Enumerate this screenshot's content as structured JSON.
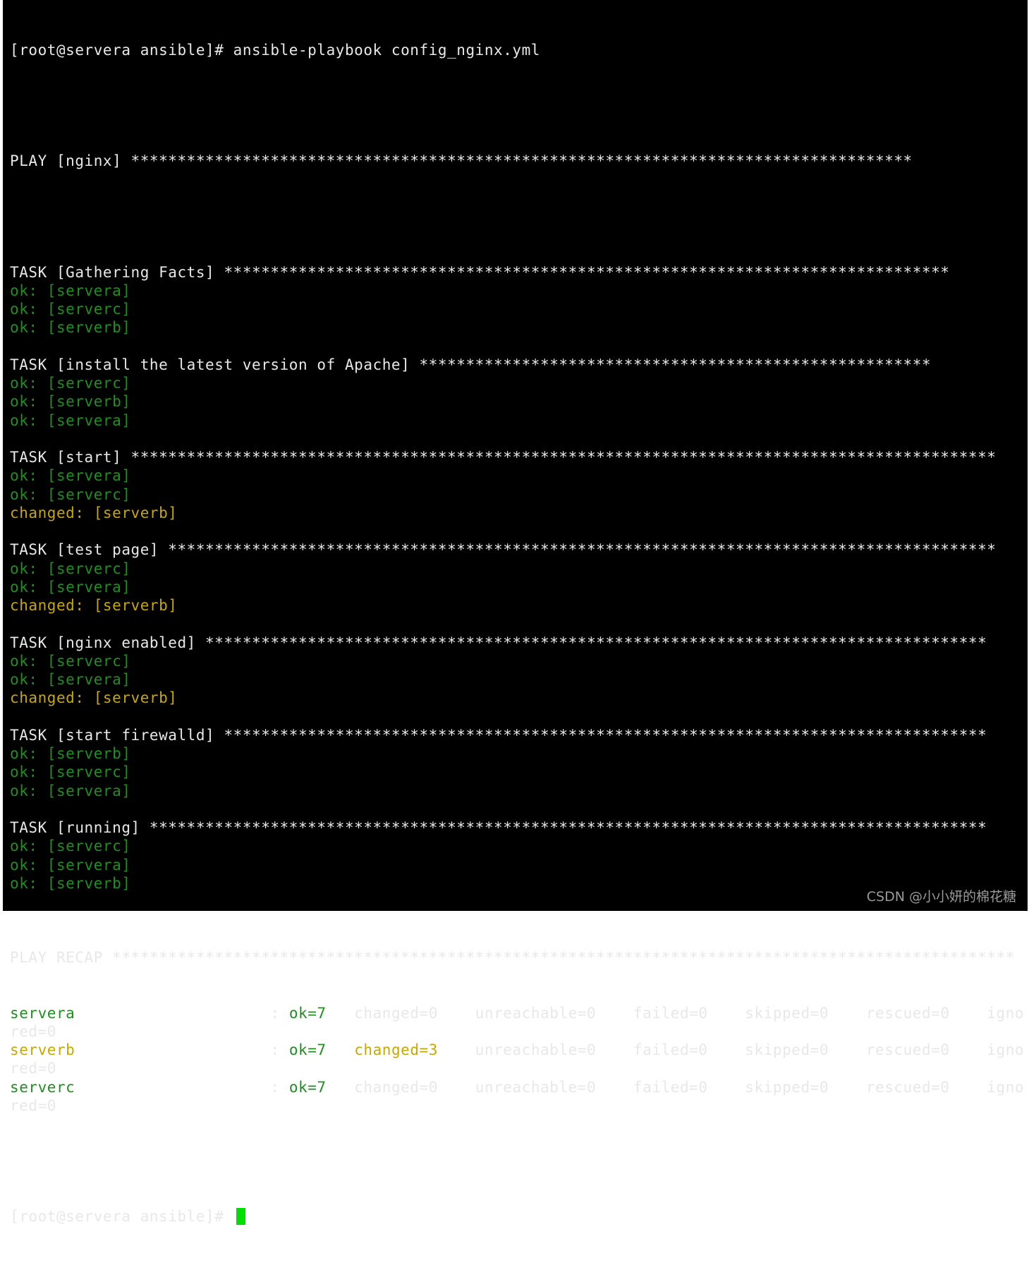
{
  "terminal": {
    "command_line": "[root@servera ansible]# ansible-playbook config_nginx.yml",
    "play_header": "PLAY [nginx] ************************************************************************************",
    "tasks": [
      {
        "header": "TASK [Gathering Facts] ******************************************************************************",
        "results": [
          {
            "status": "ok",
            "text": "ok: [servera]"
          },
          {
            "status": "ok",
            "text": "ok: [serverc]"
          },
          {
            "status": "ok",
            "text": "ok: [serverb]"
          }
        ]
      },
      {
        "header": "TASK [install the latest version of Apache] *******************************************************",
        "results": [
          {
            "status": "ok",
            "text": "ok: [serverc]"
          },
          {
            "status": "ok",
            "text": "ok: [serverb]"
          },
          {
            "status": "ok",
            "text": "ok: [servera]"
          }
        ]
      },
      {
        "header": "TASK [start] *********************************************************************************************",
        "results": [
          {
            "status": "ok",
            "text": "ok: [servera]"
          },
          {
            "status": "ok",
            "text": "ok: [serverc]"
          },
          {
            "status": "changed",
            "text": "changed: [serverb]"
          }
        ]
      },
      {
        "header": "TASK [test page] *****************************************************************************************",
        "results": [
          {
            "status": "ok",
            "text": "ok: [serverc]"
          },
          {
            "status": "ok",
            "text": "ok: [servera]"
          },
          {
            "status": "changed",
            "text": "changed: [serverb]"
          }
        ]
      },
      {
        "header": "TASK [nginx enabled] ************************************************************************************",
        "results": [
          {
            "status": "ok",
            "text": "ok: [serverc]"
          },
          {
            "status": "ok",
            "text": "ok: [servera]"
          },
          {
            "status": "changed",
            "text": "changed: [serverb]"
          }
        ]
      },
      {
        "header": "TASK [start firewalld] **********************************************************************************",
        "results": [
          {
            "status": "ok",
            "text": "ok: [serverb]"
          },
          {
            "status": "ok",
            "text": "ok: [serverc]"
          },
          {
            "status": "ok",
            "text": "ok: [servera]"
          }
        ]
      },
      {
        "header": "TASK [running] ******************************************************************************************",
        "results": [
          {
            "status": "ok",
            "text": "ok: [serverc]"
          },
          {
            "status": "ok",
            "text": "ok: [servera]"
          },
          {
            "status": "ok",
            "text": "ok: [serverb]"
          }
        ]
      }
    ],
    "recap_header": "PLAY RECAP *************************************************************************************************",
    "recap": [
      {
        "host": "servera",
        "host_status": "ok",
        "sep": "                     : ",
        "ok": "ok=7",
        "changed": "changed=0",
        "changed_status": "normal",
        "rest": "    unreachable=0    failed=0    skipped=0    rescued=0    igno",
        "wrap": "red=0"
      },
      {
        "host": "serverb",
        "host_status": "changed",
        "sep": "                     : ",
        "ok": "ok=7",
        "changed": "changed=3",
        "changed_status": "changed",
        "rest": "    unreachable=0    failed=0    skipped=0    rescued=0    igno",
        "wrap": "red=0"
      },
      {
        "host": "serverc",
        "host_status": "ok",
        "sep": "                     : ",
        "ok": "ok=7",
        "changed": "changed=0",
        "changed_status": "normal",
        "rest": "    unreachable=0    failed=0    skipped=0    rescued=0    igno",
        "wrap": "red=0"
      }
    ],
    "prompt": "[root@servera ansible]# "
  },
  "watermark": "CSDN @小小妍的棉花糖",
  "colors": {
    "background": "#000000",
    "text": "#e8e8e8",
    "ok": "#1f8f1f",
    "changed": "#c8a800",
    "cursor": "#00e000"
  }
}
